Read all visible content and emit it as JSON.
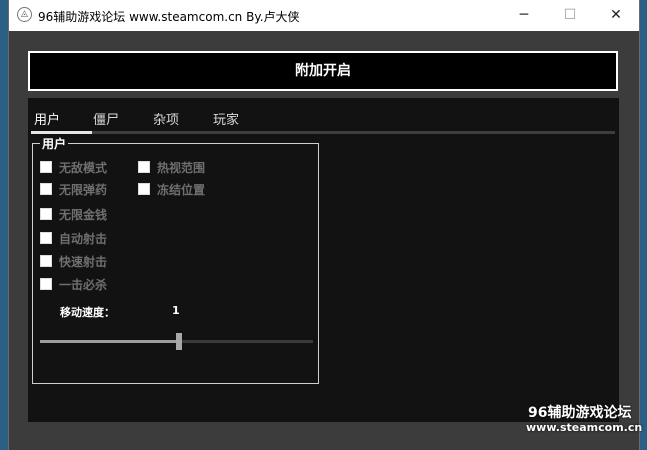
{
  "window": {
    "title": "96辅助游戏论坛 www.steamcom.cn By.卢大侠",
    "icon": "app-icon",
    "controls": {
      "minimize": "─",
      "maximize": "☐",
      "close": "✕"
    }
  },
  "attach_button": {
    "label": "附加开启"
  },
  "tabs": [
    {
      "label": "用户",
      "active": true
    },
    {
      "label": "僵尸",
      "active": false
    },
    {
      "label": "杂项",
      "active": false
    },
    {
      "label": "玩家",
      "active": false
    }
  ],
  "user_group": {
    "title": "用户",
    "options": [
      {
        "label": "无敌模式",
        "checked": false
      },
      {
        "label": "热视范围",
        "checked": false
      },
      {
        "label": "无限弹药",
        "checked": false
      },
      {
        "label": "冻结位置",
        "checked": false
      },
      {
        "label": "无限金钱",
        "checked": false
      },
      {
        "label": "自动射击",
        "checked": false
      },
      {
        "label": "快速射击",
        "checked": false
      },
      {
        "label": "一击必杀",
        "checked": false
      }
    ],
    "speed": {
      "label": "移动速度：",
      "value": "1",
      "fraction": 0.5
    }
  },
  "watermark": {
    "line1": "96辅助游戏论坛",
    "line2": "www.steamcom.cn"
  },
  "colors": {
    "panel": "#121212",
    "accent": "#ffffff",
    "disabled_text": "#6f6f6f"
  }
}
